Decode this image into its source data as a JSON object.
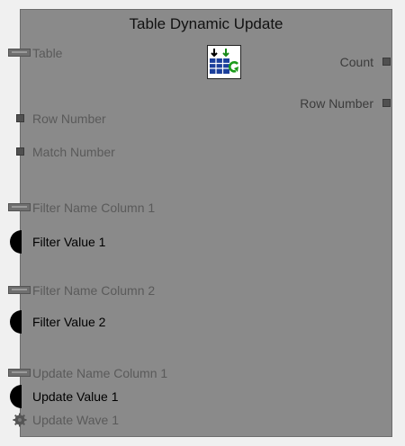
{
  "node": {
    "title": "Table Dynamic Update",
    "icon": "table-refresh-icon",
    "inputs": [
      {
        "label": "Table",
        "connector": "bus-connector",
        "state": "disabled"
      },
      {
        "label": "Row Number",
        "connector": "square-connector",
        "state": "disabled"
      },
      {
        "label": "Match Number",
        "connector": "square-connector",
        "state": "disabled"
      },
      {
        "label": "Filter Name Column 1",
        "connector": "bus-connector",
        "state": "disabled"
      },
      {
        "label": "Filter Value 1",
        "connector": "half-circle-connector",
        "state": "active"
      },
      {
        "label": "Filter Name Column 2",
        "connector": "bus-connector",
        "state": "disabled"
      },
      {
        "label": "Filter Value 2",
        "connector": "half-circle-connector",
        "state": "active"
      },
      {
        "label": "Update Name Column 1",
        "connector": "bus-connector",
        "state": "disabled"
      },
      {
        "label": "Update Value 1",
        "connector": "half-circle-connector",
        "state": "active"
      },
      {
        "label": "Update Wave 1",
        "connector": "gear-connector",
        "state": "disabled"
      }
    ],
    "outputs": [
      {
        "label": "Count",
        "connector": "square-connector"
      },
      {
        "label": "Row Number",
        "connector": "square-connector"
      }
    ],
    "colors": {
      "body": "#8a8a8a",
      "disabled_label": "#5a5a5a",
      "active_label": "#000000"
    }
  }
}
